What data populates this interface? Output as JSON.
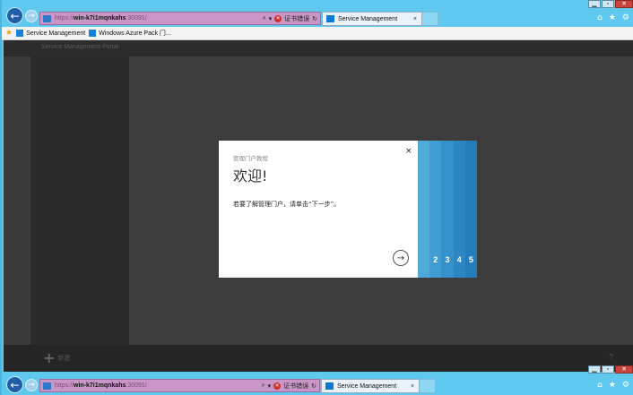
{
  "browser": {
    "address": {
      "protocol": "https://",
      "host": "win-k7i1mqnkahs",
      "port": ":30091/"
    },
    "cert_error_label": "证书错误",
    "tab_title": "Service Management",
    "tab_close": "×"
  },
  "browser_bottom": {
    "address": {
      "protocol": "https://",
      "host": "win-k7i1mqnkahs",
      "port": ":30091/"
    },
    "cert_error_label": "证书错误",
    "tab_title": "Service Management"
  },
  "favorites": {
    "items": [
      {
        "label": "Service Management"
      },
      {
        "label": "Windows Azure Pack 门..."
      }
    ]
  },
  "portal": {
    "title": "Service Management Portal",
    "new_label": "新建"
  },
  "tour": {
    "header": "管理门户教程",
    "title": "欢迎!",
    "body": "若要了解管理门户，请单击“下一步”。",
    "close": "×",
    "steps": [
      {
        "label": "",
        "color": "#4fa9d9"
      },
      {
        "label": "2",
        "color": "#3f9dd2"
      },
      {
        "label": "3",
        "color": "#3591ca"
      },
      {
        "label": "4",
        "color": "#2d86c2"
      },
      {
        "label": "5",
        "color": "#257cbb"
      }
    ]
  },
  "colors": {
    "chrome": "#5fc8ee",
    "address_bg": "#c996c7",
    "portal_bg": "#3a3a3a",
    "modal_bg": "#ffffff"
  }
}
